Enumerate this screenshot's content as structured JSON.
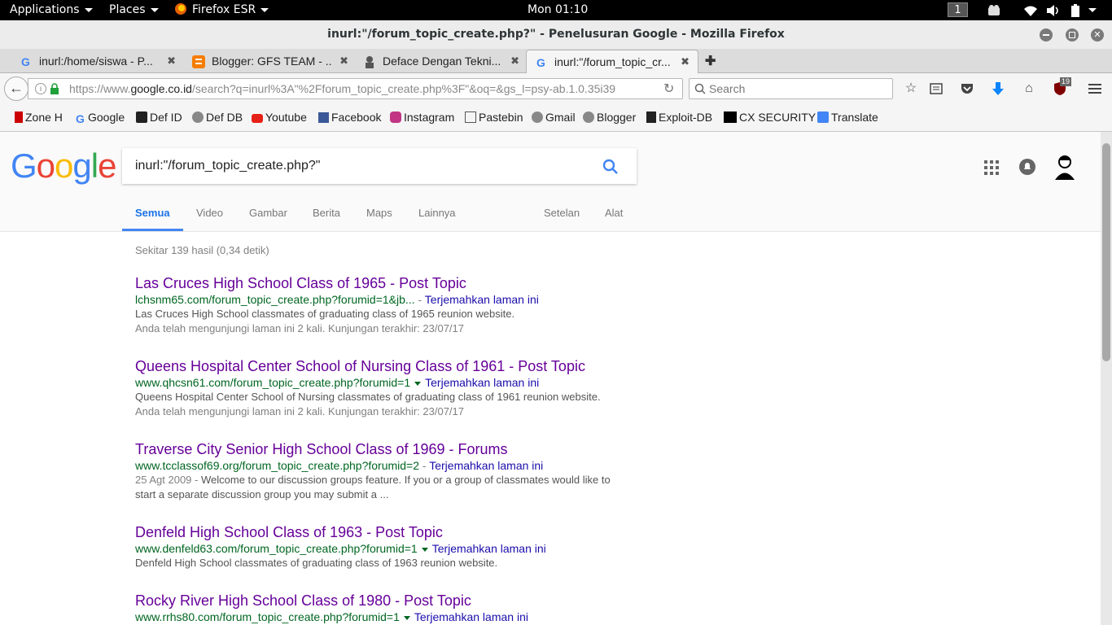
{
  "topbar": {
    "applications": "Applications",
    "places": "Places",
    "firefox": "Firefox ESR",
    "clock": "Mon 01:10",
    "workspace": "1"
  },
  "window": {
    "title": "inurl:\"/forum_topic_create.php?\" - Penelusuran Google - Mozilla Firefox"
  },
  "tabs": [
    {
      "label": "inurl:/home/siswa - P..."
    },
    {
      "label": "Blogger: GFS TEAM - ..."
    },
    {
      "label": "Deface Dengan Tekni..."
    },
    {
      "label": "inurl:\"/forum_topic_cr..."
    }
  ],
  "nav": {
    "url_prefix": "https://www.",
    "url_host": "google.co.id",
    "url_rest": "/search?q=inurl%3A\"%2Fforum_topic_create.php%3F\"&oq=&gs_l=psy-ab.1.0.35i39",
    "search_placeholder": "Search",
    "badge": "19"
  },
  "bookmarks": [
    {
      "label": "Zone H",
      "color": "#cc0000"
    },
    {
      "label": "Google",
      "color": "#4285f4"
    },
    {
      "label": "Def ID",
      "color": "#222222"
    },
    {
      "label": "Def DB",
      "color": "#666666"
    },
    {
      "label": "Youtube",
      "color": "#e62117"
    },
    {
      "label": "Facebook",
      "color": "#3b5998"
    },
    {
      "label": "Instagram",
      "color": "#c13584"
    },
    {
      "label": "Pastebin",
      "color": "#555555"
    },
    {
      "label": "Gmail",
      "color": "#666666"
    },
    {
      "label": "Blogger",
      "color": "#666666"
    },
    {
      "label": "Exploit-DB",
      "color": "#222222"
    },
    {
      "label": "CX SECURITY",
      "color": "#000000"
    },
    {
      "label": "Translate",
      "color": "#4285f4"
    }
  ],
  "google": {
    "query": "inurl:\"/forum_topic_create.php?\"",
    "tabs": [
      "Semua",
      "Video",
      "Gambar",
      "Berita",
      "Maps",
      "Lainnya",
      "Setelan",
      "Alat"
    ],
    "stats": "Sekitar 139 hasil (0,34 detik)",
    "results": [
      {
        "title": "Las Cruces High School Class of 1965 - Post Topic",
        "url": "lchsnm65.com/forum_topic_create.php?forumid=1&jb...",
        "translate": "Terjemahkan laman ini",
        "snippet": "Las Cruces High School classmates of graduating class of 1965 reunion website.",
        "visited": "Anda telah mengunjungi laman ini 2 kali. Kunjungan terakhir: 23/07/17"
      },
      {
        "title": "Queens Hospital Center School of Nursing Class of 1961 - Post Topic",
        "url": "www.qhcsn61.com/forum_topic_create.php?forumid=1",
        "translate": "Terjemahkan laman ini",
        "snippet": "Queens Hospital Center School of Nursing classmates of graduating class of 1961 reunion website.",
        "visited": "Anda telah mengunjungi laman ini 2 kali. Kunjungan terakhir: 23/07/17"
      },
      {
        "title": "Traverse City Senior High School Class of 1969 - Forums",
        "url": "www.tcclassof69.org/forum_topic_create.php?forumid=2",
        "translate": "Terjemahkan laman ini",
        "date": "25 Agt 2009",
        "snippet": "Welcome to our discussion groups feature. If you or a group of classmates would like to",
        "snippet2": "start a separate discussion group you may submit a ..."
      },
      {
        "title": "Denfeld High School Class of 1963 - Post Topic",
        "url": "www.denfeld63.com/forum_topic_create.php?forumid=1",
        "translate": "Terjemahkan laman ini",
        "snippet": "Denfeld High School classmates of graduating class of 1963 reunion website."
      },
      {
        "title": "Rocky River High School Class of 1980 - Post Topic",
        "url": "www.rrhs80.com/forum_topic_create.php?forumid=1",
        "translate": "Terjemahkan laman ini"
      }
    ]
  }
}
